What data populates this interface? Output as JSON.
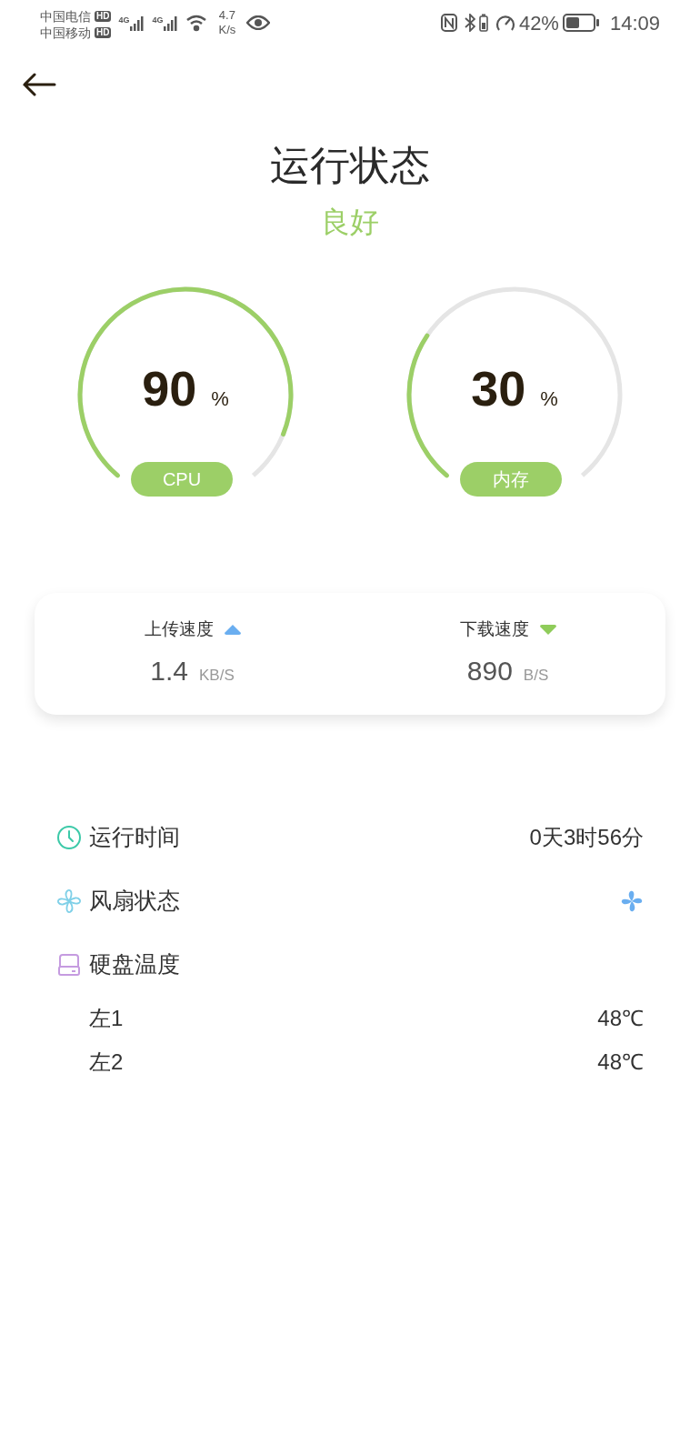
{
  "status_bar": {
    "carriers": [
      {
        "name": "中国电信",
        "badge": "HD"
      },
      {
        "name": "中国移动",
        "badge": "HD"
      }
    ],
    "signals": [
      {
        "label": "4G"
      },
      {
        "label": "4G"
      }
    ],
    "net_speed": {
      "value": "4.7",
      "unit": "K/s"
    },
    "battery_percent": "42%",
    "time": "14:09"
  },
  "header": {
    "title": "运行状态",
    "status": "良好"
  },
  "gauges": [
    {
      "value": "90",
      "unit": "%",
      "label": "CPU"
    },
    {
      "value": "30",
      "unit": "%",
      "label": "内存"
    }
  ],
  "speeds": [
    {
      "label": "上传速度",
      "kind": "upload",
      "value": "1.4",
      "unit": "KB/S"
    },
    {
      "label": "下载速度",
      "kind": "download",
      "value": "890",
      "unit": "B/S"
    }
  ],
  "info_rows": [
    {
      "kind": "uptime",
      "label": "运行时间",
      "value": "0天3时56分"
    },
    {
      "kind": "fan",
      "label": "风扇状态"
    },
    {
      "kind": "disk",
      "label": "硬盘温度",
      "children": [
        {
          "label": "左1",
          "value": "48℃"
        },
        {
          "label": "左2",
          "value": "48℃"
        }
      ]
    }
  ]
}
